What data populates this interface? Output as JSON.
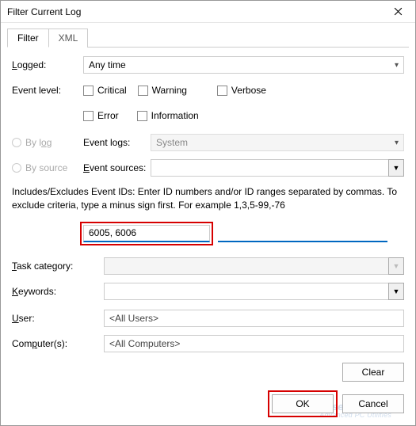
{
  "window": {
    "title": "Filter Current Log"
  },
  "tabs": {
    "filter": "Filter",
    "xml": "XML"
  },
  "labels": {
    "logged": "Logged:",
    "event_level": "Event level:",
    "by_log": "By log",
    "by_source": "By source",
    "event_logs": "Event logs:",
    "event_sources": "Event sources:",
    "task_category": "Task category:",
    "keywords": "Keywords:",
    "user": "User:",
    "computers": "Computer(s):"
  },
  "logged": {
    "selected": "Any time"
  },
  "event_level": {
    "critical": "Critical",
    "warning": "Warning",
    "verbose": "Verbose",
    "error": "Error",
    "information": "Information"
  },
  "event_logs": {
    "selected": "System"
  },
  "instructions": "Includes/Excludes Event IDs: Enter ID numbers and/or ID ranges separated by commas. To exclude criteria, type a minus sign first. For example 1,3,5-99,-76",
  "event_ids": {
    "value": "6005, 6006"
  },
  "user": {
    "value": "<All Users>"
  },
  "computers": {
    "value": "<All Computers>"
  },
  "buttons": {
    "clear": "Clear",
    "ok": "OK",
    "cancel": "Cancel"
  },
  "watermark": {
    "main": "WiseCleaner",
    "sub": "Advanced PC Utilities"
  }
}
